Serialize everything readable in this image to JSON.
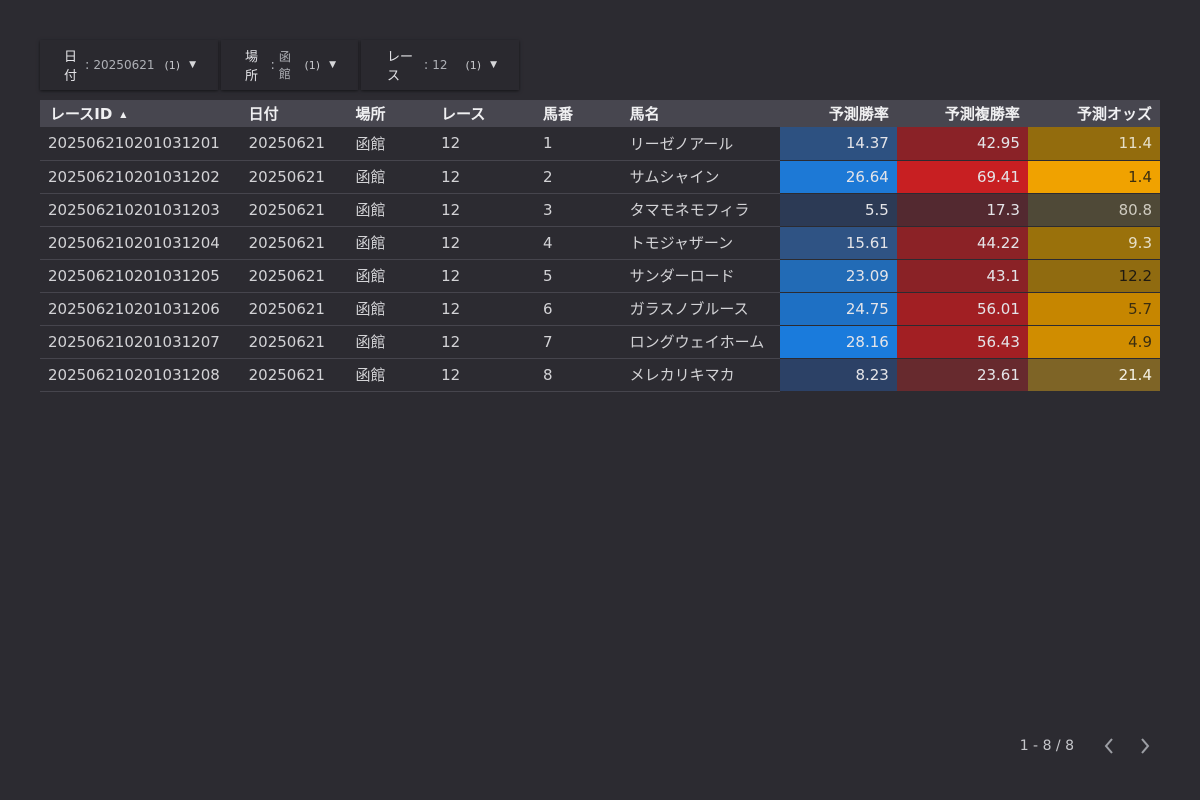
{
  "filters": [
    {
      "label": "日付",
      "sep": ":",
      "value": "20250621",
      "count": "(1)"
    },
    {
      "label": "場所",
      "sep": ":",
      "value": "函館",
      "count": "(1)"
    },
    {
      "label": "レース",
      "sep": ":",
      "value": "12",
      "count": "(1)"
    }
  ],
  "table": {
    "headers": [
      "レースID",
      "日付",
      "場所",
      "レース",
      "馬番",
      "馬名",
      "予測勝率",
      "予測複勝率",
      "予測オッズ"
    ],
    "sort_indicator": "▲",
    "rows": [
      {
        "id": "202506210201031201",
        "date": "20250621",
        "place": "函館",
        "race": "12",
        "num": "1",
        "name": "リーゼノアール",
        "win": "14.37",
        "show": "42.95",
        "odds": "11.4",
        "win_bg": "#2d5181",
        "show_bg": "#8a2227",
        "odds_bg": "#936c0d",
        "odds_fg": "#e6dfc9"
      },
      {
        "id": "202506210201031202",
        "date": "20250621",
        "place": "函館",
        "race": "12",
        "num": "2",
        "name": "サムシャイン",
        "win": "26.64",
        "show": "69.41",
        "odds": "1.4",
        "win_bg": "#1d79d6",
        "show_bg": "#c81f22",
        "odds_bg": "#f0a200",
        "odds_fg": "#3b2e10"
      },
      {
        "id": "202506210201031203",
        "date": "20250621",
        "place": "函館",
        "race": "12",
        "num": "3",
        "name": "タマモネモフィラ",
        "win": "5.5",
        "show": "17.3",
        "odds": "80.8",
        "win_bg": "#2c3a55",
        "show_bg": "#532930",
        "odds_bg": "#4f4937",
        "odds_fg": "#cfcbc0"
      },
      {
        "id": "202506210201031204",
        "date": "20250621",
        "place": "函館",
        "race": "12",
        "num": "4",
        "name": "トモジャザーン",
        "win": "15.61",
        "show": "44.22",
        "odds": "9.3",
        "win_bg": "#2f5384",
        "show_bg": "#8b2226",
        "odds_bg": "#9a710b",
        "odds_fg": "#e6dfc9"
      },
      {
        "id": "202506210201031205",
        "date": "20250621",
        "place": "函館",
        "race": "12",
        "num": "5",
        "name": "サンダーロード",
        "win": "23.09",
        "show": "43.1",
        "odds": "12.2",
        "win_bg": "#226bb6",
        "show_bg": "#8a2226",
        "odds_bg": "#906b10",
        "odds_fg": "#1f1a10"
      },
      {
        "id": "202506210201031206",
        "date": "20250621",
        "place": "函館",
        "race": "12",
        "num": "6",
        "name": "ガラスノブルース",
        "win": "24.75",
        "show": "56.01",
        "odds": "5.7",
        "win_bg": "#1e70c4",
        "show_bg": "#a11f23",
        "odds_bg": "#c68600",
        "odds_fg": "#3b2e10"
      },
      {
        "id": "202506210201031207",
        "date": "20250621",
        "place": "函館",
        "race": "12",
        "num": "7",
        "name": "ロングウェイホーム",
        "win": "28.16",
        "show": "56.43",
        "odds": "4.9",
        "win_bg": "#1a7bdc",
        "show_bg": "#a21f23",
        "odds_bg": "#d08d00",
        "odds_fg": "#3b2e10"
      },
      {
        "id": "202506210201031208",
        "date": "20250621",
        "place": "函館",
        "race": "12",
        "num": "8",
        "name": "メレカリキマカ",
        "win": "8.23",
        "show": "23.61",
        "odds": "21.4",
        "win_bg": "#2c4166",
        "show_bg": "#672a2e",
        "odds_bg": "#7e6426",
        "odds_fg": "#f4f0e4"
      }
    ]
  },
  "pagination": {
    "info": "1 - 8 / 8"
  },
  "icons": {
    "prev": "chevron-left-icon",
    "next": "chevron-right-icon",
    "dropdown": "caret-down-icon"
  }
}
